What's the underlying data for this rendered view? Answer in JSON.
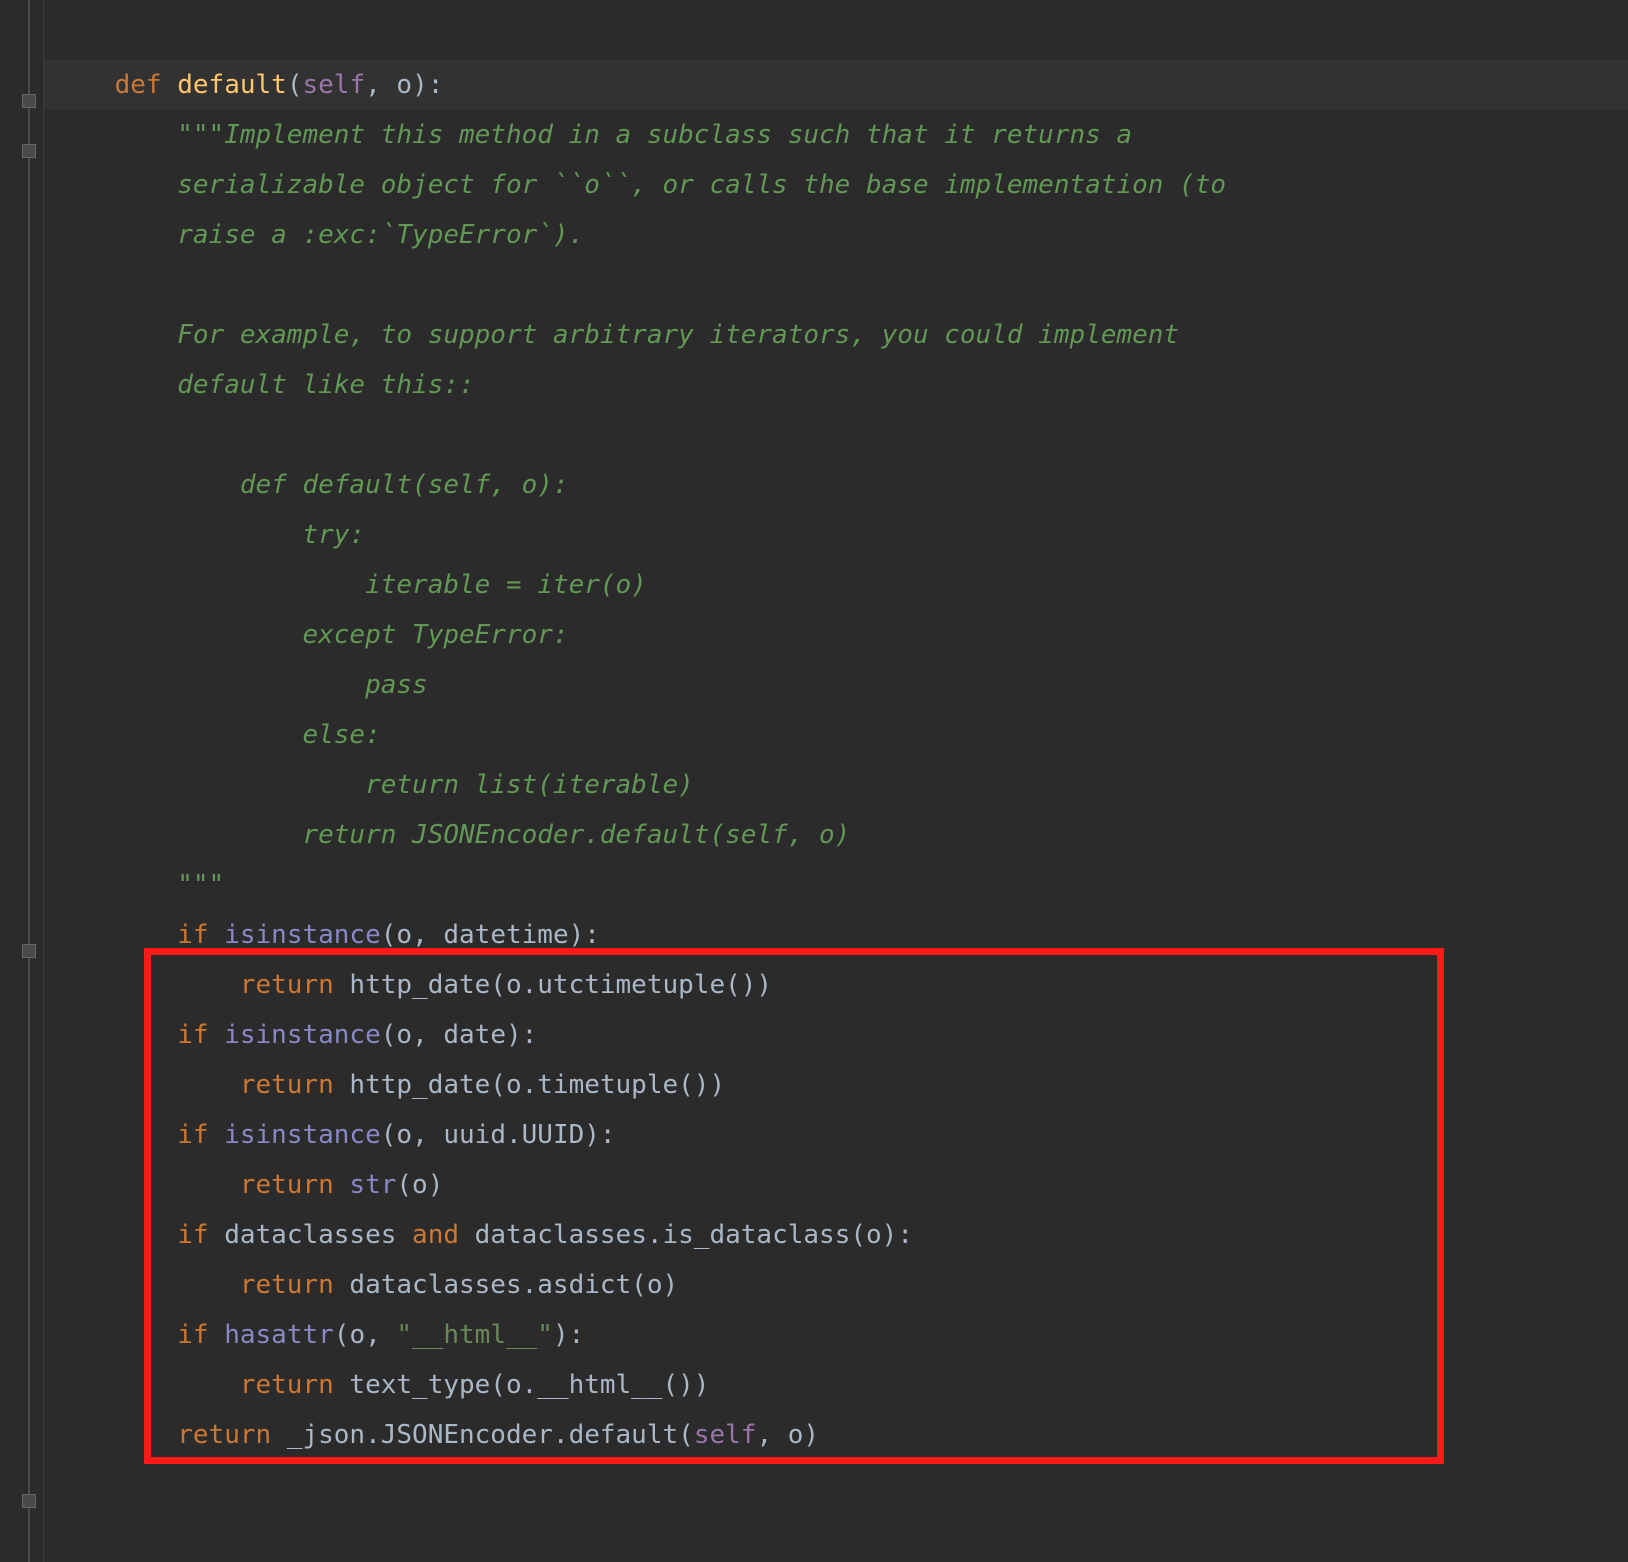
{
  "code": {
    "l1": {
      "def": "def",
      "sp1": " ",
      "fn": "default",
      "lp": "(",
      "self": "self",
      "comma": ", ",
      "o": "o",
      "rp": ")",
      "colon": ":"
    },
    "l2": "\"\"\"Implement this method in a subclass such that it returns a",
    "l3": "serializable object for ``o``, or calls the base implementation (to",
    "l4": "raise a :exc:`TypeError`).",
    "l5": "",
    "l6": "For example, to support arbitrary iterators, you could implement",
    "l7": "default like this::",
    "l8": "",
    "l9": "    def default(self, o):",
    "l10": "        try:",
    "l11": "            iterable = iter(o)",
    "l12": "        except TypeError:",
    "l13": "            pass",
    "l14": "        else:",
    "l15": "            return list(iterable)",
    "l16": "        return JSONEncoder.default(self, o)",
    "l17": "\"\"\"",
    "l18": {
      "if": "if",
      "sp": " ",
      "isinst": "isinstance",
      "lp": "(",
      "o": "o",
      "comma": ", ",
      "type": "datetime",
      "rp": ")",
      "colon": ":"
    },
    "l19": {
      "ret": "return",
      "sp": " ",
      "call": "http_date(o.utctimetuple())"
    },
    "l20": {
      "if": "if",
      "sp": " ",
      "isinst": "isinstance",
      "lp": "(",
      "o": "o",
      "comma": ", ",
      "type": "date",
      "rp": ")",
      "colon": ":"
    },
    "l21": {
      "ret": "return",
      "sp": " ",
      "call": "http_date(o.timetuple())"
    },
    "l22": {
      "if": "if",
      "sp": " ",
      "isinst": "isinstance",
      "lp": "(",
      "o": "o",
      "comma": ", ",
      "type": "uuid.UUID",
      "rp": ")",
      "colon": ":"
    },
    "l23": {
      "ret": "return",
      "sp": " ",
      "fn": "str",
      "lp": "(",
      "o": "o",
      "rp": ")"
    },
    "l24": {
      "if": "if",
      "sp": " ",
      "a": "dataclasses",
      "and": " and ",
      "b": "dataclasses.is_dataclass(o)",
      "colon": ":"
    },
    "l25": {
      "ret": "return",
      "sp": " ",
      "call": "dataclasses.asdict(o)"
    },
    "l26": {
      "if": "if",
      "sp": " ",
      "has": "hasattr",
      "lp": "(",
      "o": "o",
      "comma": ", ",
      "str": "\"__html__\"",
      "rp": ")",
      "colon": ":"
    },
    "l27": {
      "ret": "return",
      "sp": " ",
      "call": "text_type(o.__html__())"
    },
    "l28": {
      "ret": "return",
      "sp": " ",
      "a": "_json.JSONEncoder.default(",
      "self": "self",
      "comma": ", ",
      "o": "o",
      "rp": ")"
    }
  },
  "indent": {
    "i1": "    ",
    "i2": "        ",
    "i3": "            "
  }
}
